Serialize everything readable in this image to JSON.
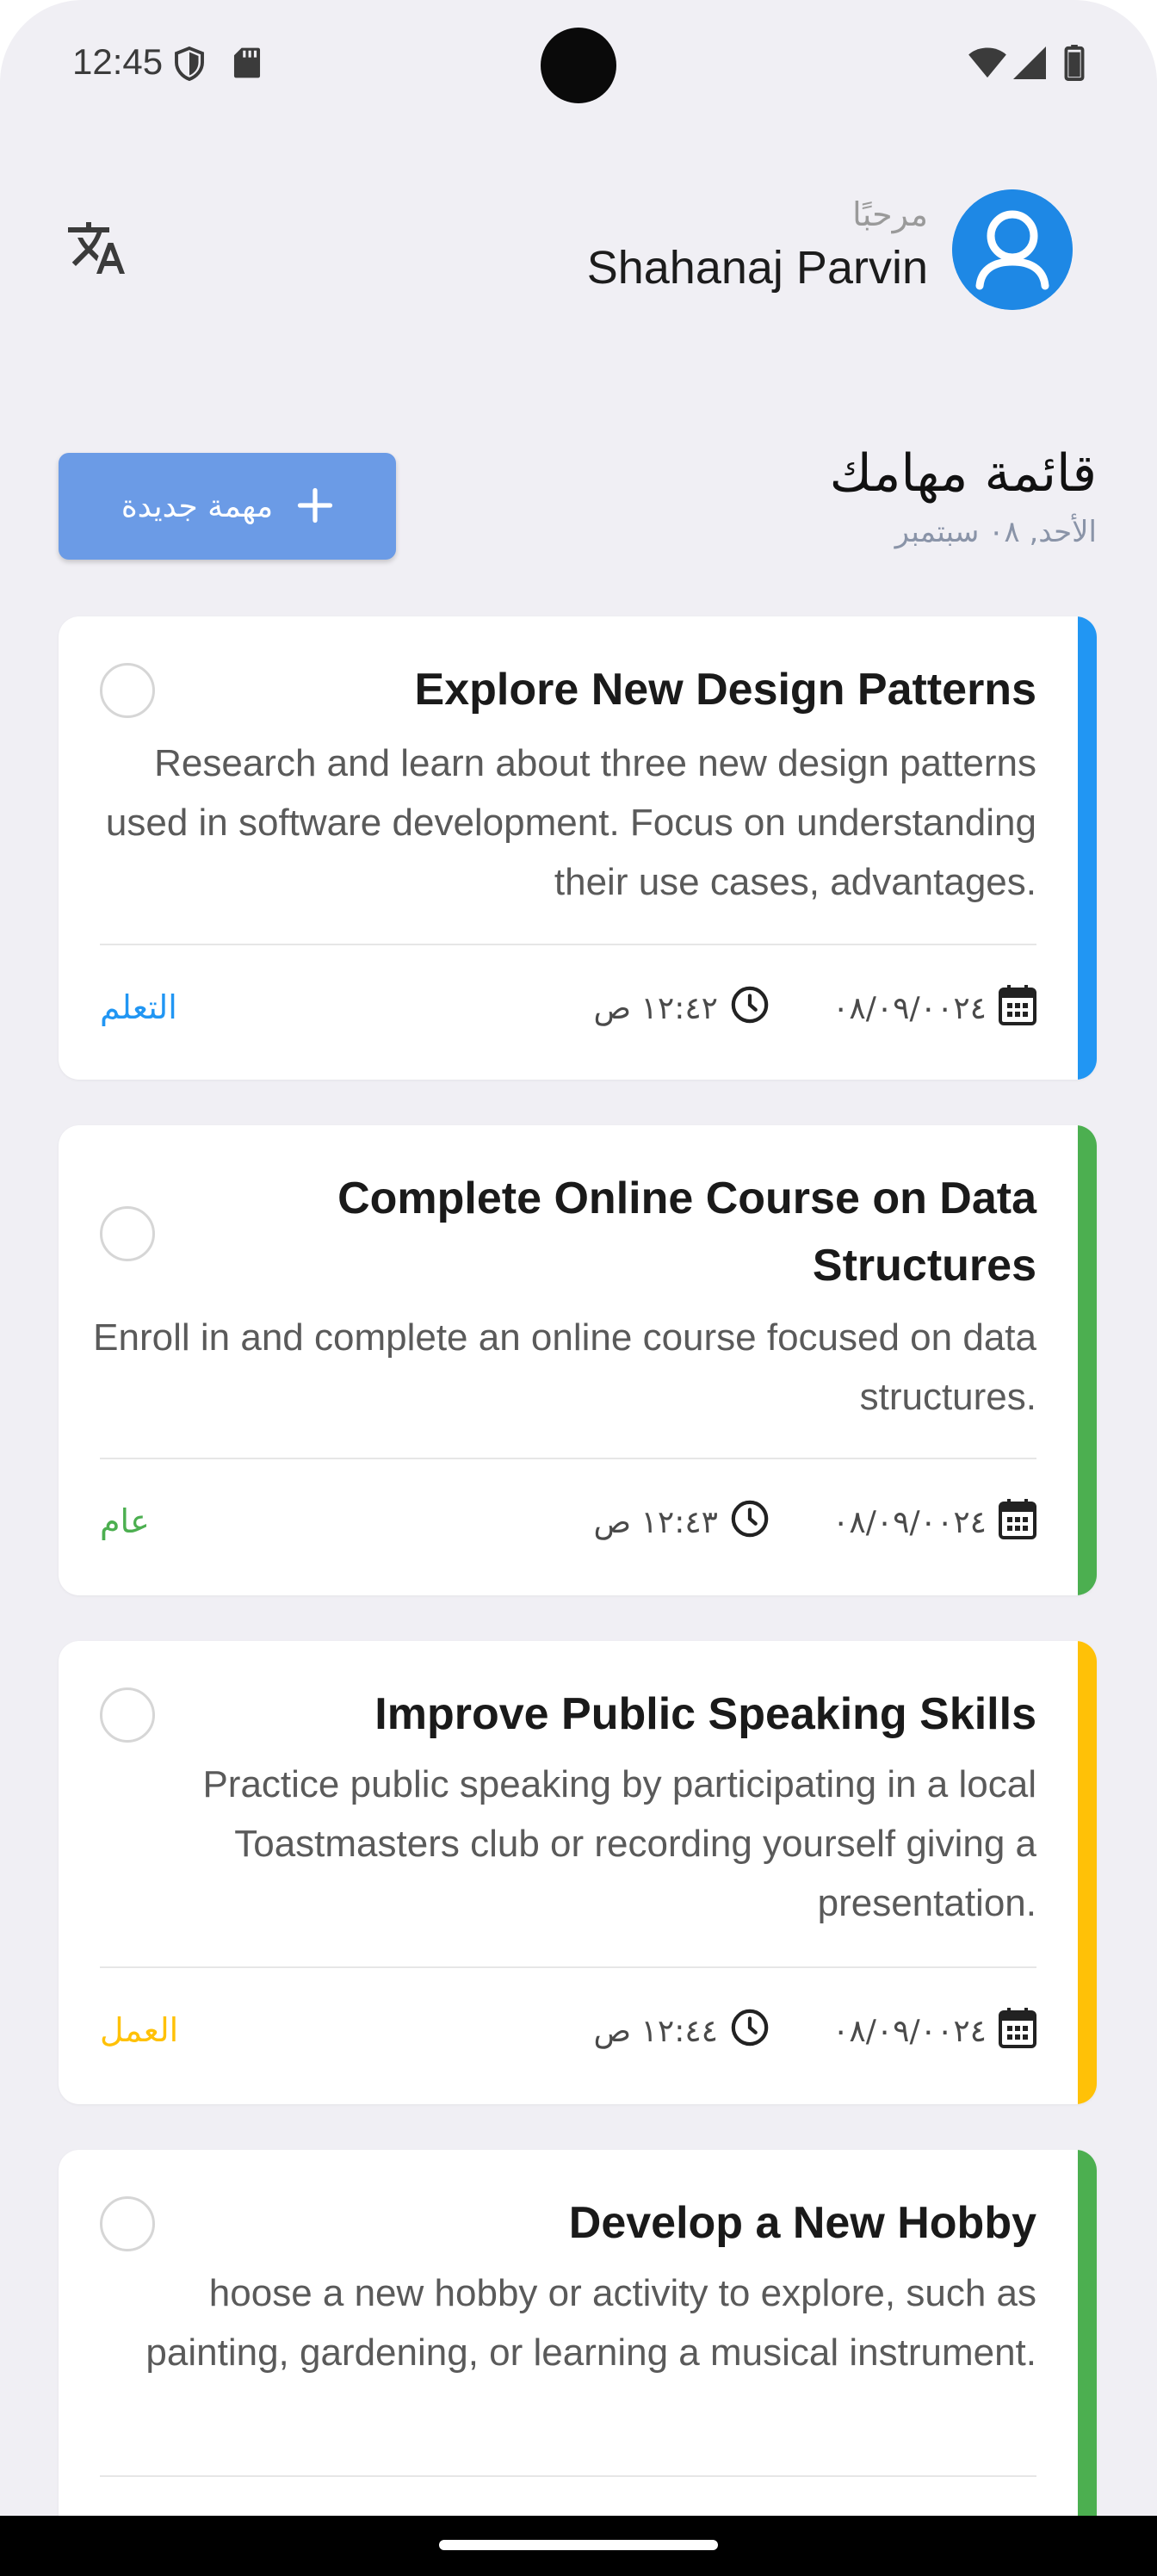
{
  "status_bar": {
    "time": "12:45",
    "icons": [
      "shield-icon",
      "sd-card-icon",
      "wifi-icon",
      "signal-icon",
      "battery-icon"
    ]
  },
  "header": {
    "greeting": "مرحبًا",
    "user_name": "Shahanaj Parvin",
    "translate_icon": "translate-icon",
    "avatar_icon": "person-icon",
    "avatar_color": "#1e88e5"
  },
  "list": {
    "title": "قائمة مهامك",
    "date": "الأحد, ٠٨ سبتمبر",
    "new_task_label": "مهمة جديدة",
    "new_task_color": "#6b9be6"
  },
  "tasks": [
    {
      "title": "Explore New Design Patterns",
      "description": "Research and learn about three new design patterns used in software development. Focus on understanding their use cases, advantages.",
      "date": "٠٨/٠٩/٠٠٢٤",
      "time": "١٢:٤٢ ص",
      "category": "التعلم",
      "color": "#2196f3"
    },
    {
      "title": "Complete Online Course on Data Structures",
      "description": "Enroll in and complete an online course focused on data structures.",
      "date": "٠٨/٠٩/٠٠٢٤",
      "time": "١٢:٤٣ ص",
      "category": "عام",
      "color": "#4caf50"
    },
    {
      "title": "Improve Public Speaking Skills",
      "description": "Practice public speaking by participating in a local Toastmasters club or recording yourself giving a presentation.",
      "date": "٠٨/٠٩/٠٠٢٤",
      "time": "١٢:٤٤ ص",
      "category": "العمل",
      "color": "#ffc107"
    },
    {
      "title": "Develop a New Hobby",
      "description": "hoose a new hobby or activity to explore, such as painting, gardening, or learning a musical instrument.",
      "color": "#4caf50"
    }
  ]
}
